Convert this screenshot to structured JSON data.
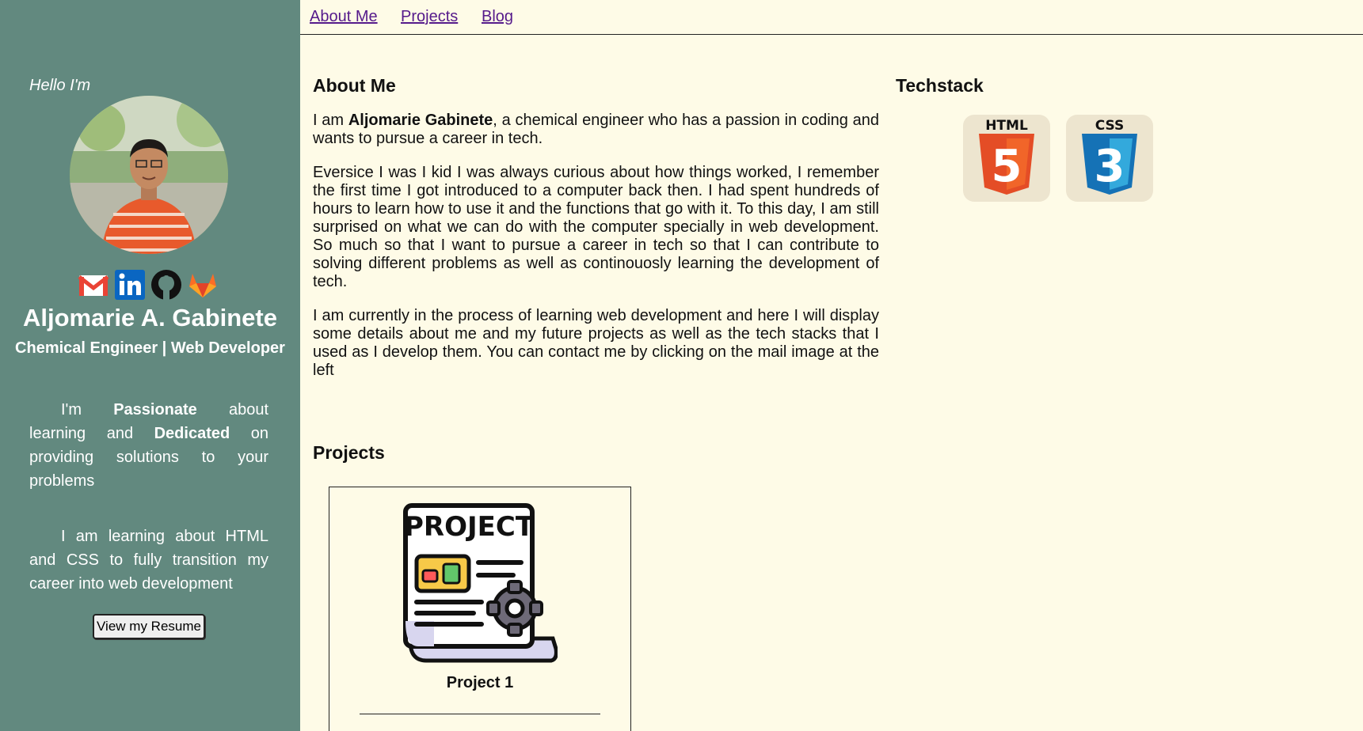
{
  "sidebar": {
    "greeting": "Hello I'm",
    "name": "Aljomarie A. Gabinete",
    "role": "Chemical Engineer | Web Developer",
    "intro": {
      "t1": "I'm ",
      "b1": "Passionate",
      "t2": " about learning and ",
      "b2": "Dedicated",
      "t3": " on providing solutions to your problems"
    },
    "learning": "I am learning about HTML and CSS to fully transition my career into web development",
    "resume_button": "View my Resume",
    "socials": [
      "gmail-icon",
      "linkedin-icon",
      "github-icon",
      "gitlab-icon"
    ]
  },
  "nav": {
    "about": "About Me",
    "projects": "Projects",
    "blog": "Blog"
  },
  "about": {
    "heading": "About Me",
    "p1_a": "I am ",
    "p1_name": "Aljomarie Gabinete",
    "p1_b": ", a chemical engineer who has a passion in coding and wants to pursue a career in tech.",
    "p2": "Eversice I was I kid I was always curious about how things worked, I remember the first time I got introduced to a computer back then. I had spent hundreds of hours to learn how to use it and the functions that go with it. To this day, I am still surprised on what we can do with the computer specially in web development. So much so that I want to pursue a career in tech so that I can contribute to solving different problems as well as continouosly learning the development of tech.",
    "p3": "I am currently in the process of learning web development and here I will display some details about me and my future projects as well as the tech stacks that I used as I develop them. You can contact me by clicking on the mail image at the left"
  },
  "techstack": {
    "heading": "Techstack",
    "items": [
      {
        "label": "HTML",
        "number": "5",
        "color": "#e44d26"
      },
      {
        "label": "CSS",
        "number": "3",
        "color": "#1572b6"
      }
    ]
  },
  "projects": {
    "heading": "Projects",
    "cards": [
      {
        "title": "Project 1",
        "image_text": "PROJECT"
      }
    ]
  },
  "colors": {
    "sidebar_bg": "#62897f",
    "page_bg": "#fefbe7",
    "link": "#551a8b"
  }
}
